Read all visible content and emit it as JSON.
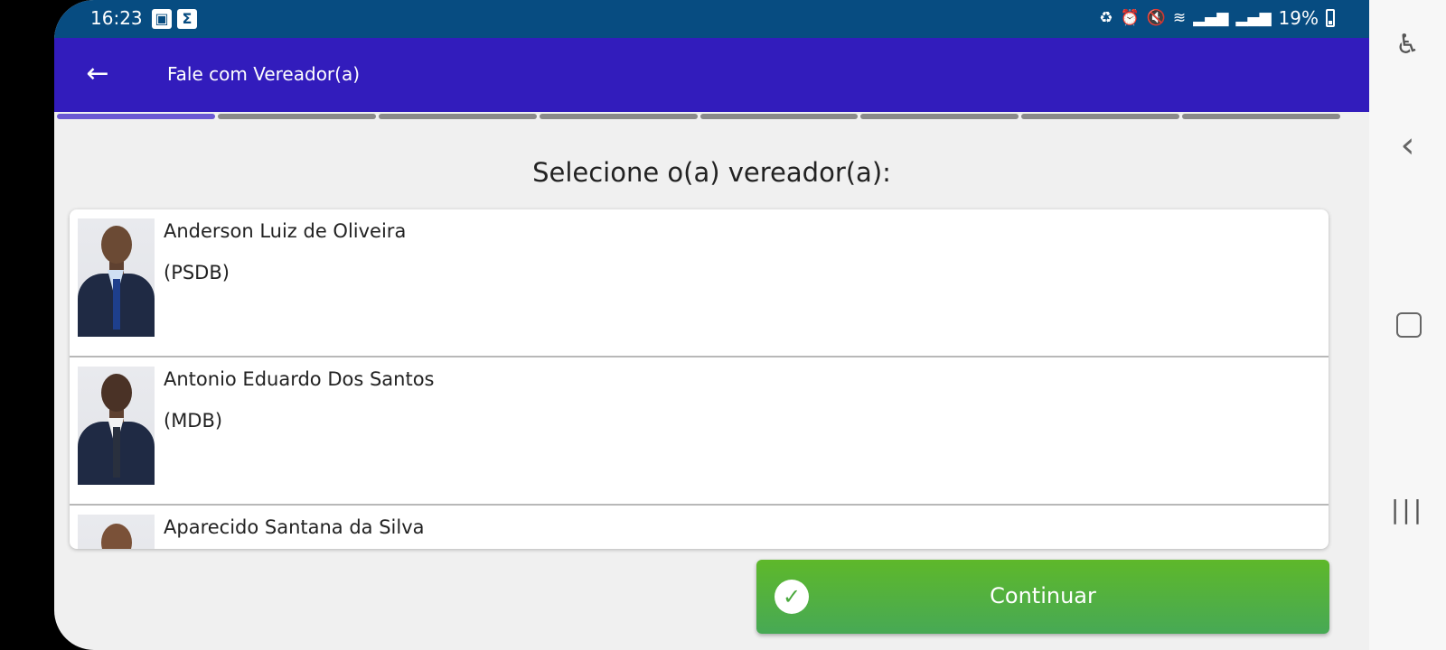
{
  "status_bar": {
    "time": "16:23",
    "notif_icons": [
      "image-icon",
      "sigma-icon"
    ],
    "battery": "19%"
  },
  "app_bar": {
    "back_icon": "←",
    "title": "Fale com Vereador(a)"
  },
  "progress": {
    "total_steps": 8,
    "current_step": 1
  },
  "heading": "Selecione o(a) vereador(a):",
  "councilors": [
    {
      "name": "Anderson Luiz de Oliveira",
      "party": "(PSDB)"
    },
    {
      "name": "Antonio Eduardo Dos Santos",
      "party": "(MDB)"
    },
    {
      "name": "Aparecido Santana da Silva",
      "party": ""
    }
  ],
  "continue_button": {
    "label": "Continuar",
    "icon": "check-circle-icon"
  },
  "colors": {
    "status_bar": "#074c81",
    "app_bar": "#321cbc",
    "progress_active": "#6b59d3",
    "button_green": "#4fae3f"
  }
}
